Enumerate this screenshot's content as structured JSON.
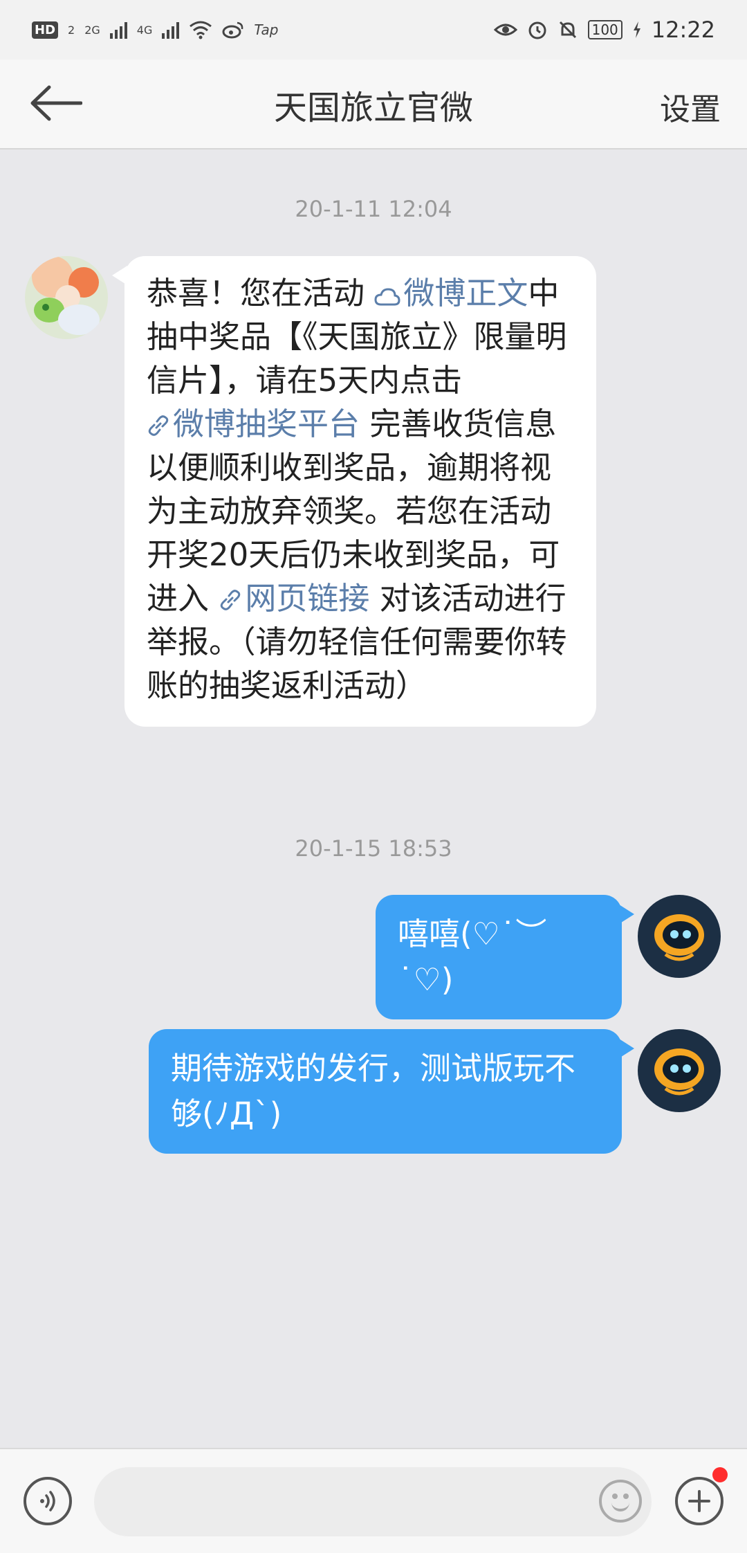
{
  "status_bar": {
    "hd": "HD",
    "sim_index": "2",
    "net1": "2G",
    "net2": "4G",
    "tap": "Tap",
    "battery": "100",
    "time": "12:22"
  },
  "nav": {
    "title": "天国旅立官微",
    "settings_label": "设置"
  },
  "messages": {
    "ts1": "20-1-11 12:04",
    "m1": {
      "p1": "恭喜！您在活动 ",
      "link1": "微博正文",
      "p2": "中抽中奖品【《天国旅立》限量明信片】，请在5天内点击 ",
      "link2": "微博抽奖平台",
      "p3": " 完善收货信息以便顺利收到奖品，逾期将视为主动放弃领奖。若您在活动开奖20天后仍未收到奖品，可进入 ",
      "link3": "网页链接",
      "p4": " 对该活动进行举报。（请勿轻信任何需要你转账的抽奖返利活动）"
    },
    "ts2": "20-1-15 18:53",
    "out1": "嘻嘻(♡˙︶˙♡)",
    "out2": "期待游戏的发行，测试版玩不够(ﾉДˋ)"
  },
  "input": {
    "placeholder": "",
    "value": ""
  },
  "colors": {
    "link": "#5b7eaa",
    "bubble_out": "#3ea2f5",
    "badge": "#ff2d2d"
  },
  "icons": [
    "back-arrow-icon",
    "voice-icon",
    "emoji-icon",
    "plus-icon",
    "cloud-icon",
    "link-icon"
  ]
}
